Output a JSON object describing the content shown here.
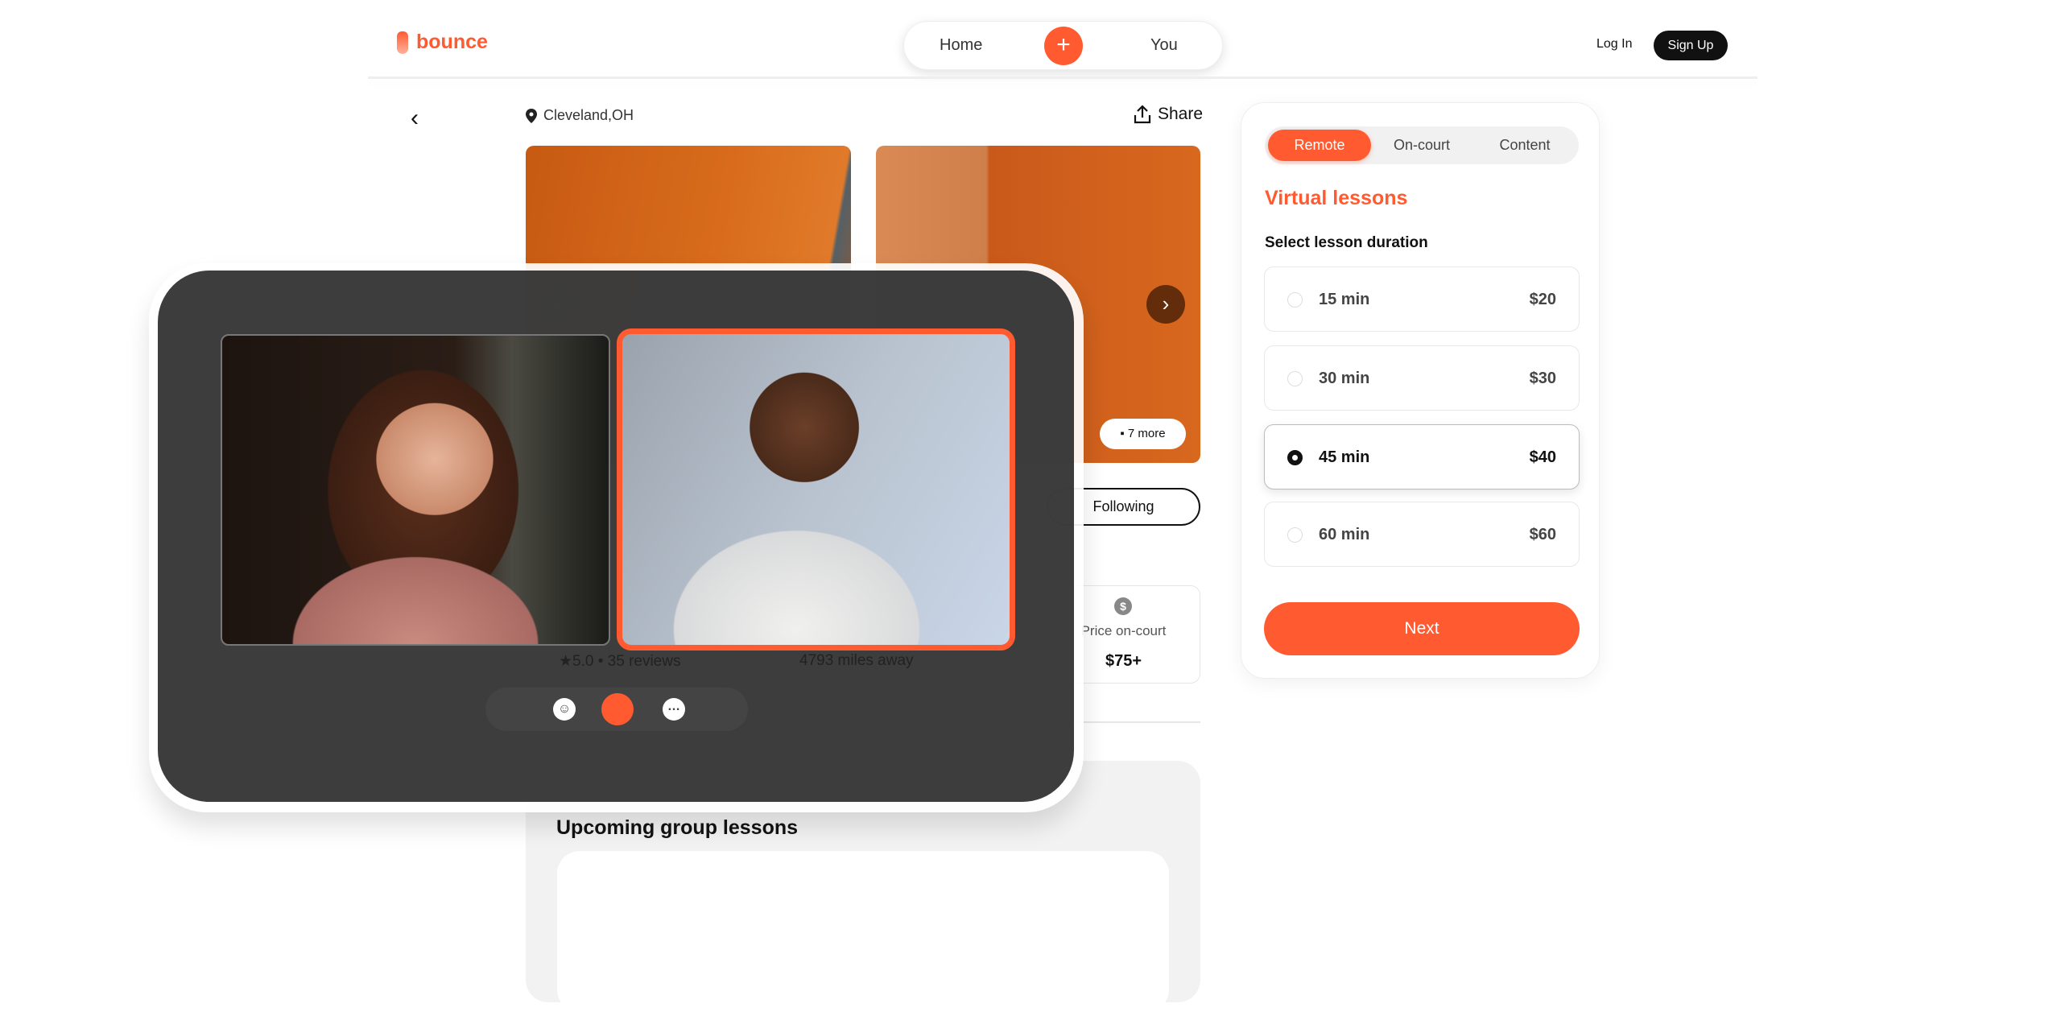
{
  "header": {
    "brand": "bounce",
    "nav": {
      "home": "Home",
      "add": "+",
      "you": "You"
    },
    "login": "Log In",
    "signup": "Sign Up"
  },
  "listing": {
    "back": "‹",
    "location": "Cleveland,OH",
    "share": "Share",
    "more_photos": "7 more",
    "following": "Following",
    "rating": "★5.0 • 35 reviews",
    "distance": "4793 miles away",
    "price_label": "Price on-court",
    "price_value": "$75+",
    "price_icon": "$",
    "upcoming_title": "Upcoming group lessons"
  },
  "booking": {
    "tabs": [
      {
        "label": "Remote",
        "active": true
      },
      {
        "label": "On-court",
        "active": false
      },
      {
        "label": "Content",
        "active": false
      }
    ],
    "title": "Virtual lessons",
    "subtitle": "Select lesson duration",
    "options": [
      {
        "duration": "15 min",
        "price": "$20",
        "selected": false
      },
      {
        "duration": "30 min",
        "price": "$30",
        "selected": false
      },
      {
        "duration": "45 min",
        "price": "$40",
        "selected": true
      },
      {
        "duration": "60 min",
        "price": "$60",
        "selected": false
      }
    ],
    "next": "Next"
  },
  "video_call": {
    "controls": {
      "emoji": "☺",
      "chat": "…"
    }
  },
  "colors": {
    "accent": "#ff5a30",
    "dark": "#282828"
  }
}
